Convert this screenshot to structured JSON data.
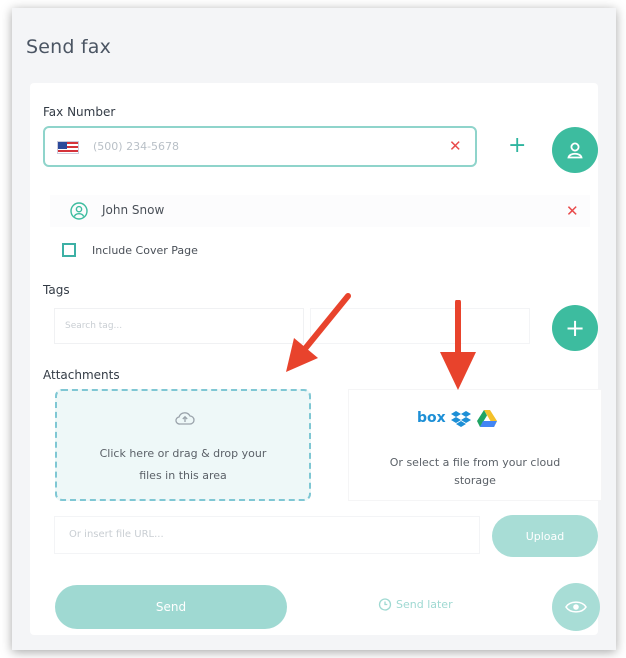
{
  "page": {
    "title": "Send fax"
  },
  "fax": {
    "label": "Fax Number",
    "placeholder": "(500) 234-5678",
    "clear_icon": "x-icon",
    "add_icon": "plus-icon",
    "contacts_icon": "contact-book-icon"
  },
  "recipient": {
    "name": "John Snow",
    "remove_icon": "x-icon"
  },
  "cover": {
    "label": "Include Cover Page"
  },
  "tags": {
    "label": "Tags",
    "placeholder": "Search tag..."
  },
  "attachments": {
    "label": "Attachments",
    "dropzone_line1": "Click here or drag & drop your",
    "dropzone_line2": "files in this area",
    "cloud_text_line1": "Or select a file from your cloud",
    "cloud_text_line2": "storage",
    "box_logo": "box",
    "url_placeholder": "Or insert file URL...",
    "upload_label": "Upload"
  },
  "actions": {
    "send_label": "Send",
    "send_later_label": "Send later"
  },
  "colors": {
    "accent": "#3dbc9f",
    "accent_light": "#9fd9d2",
    "danger": "#e94b4b",
    "arrow": "#e8432c"
  }
}
